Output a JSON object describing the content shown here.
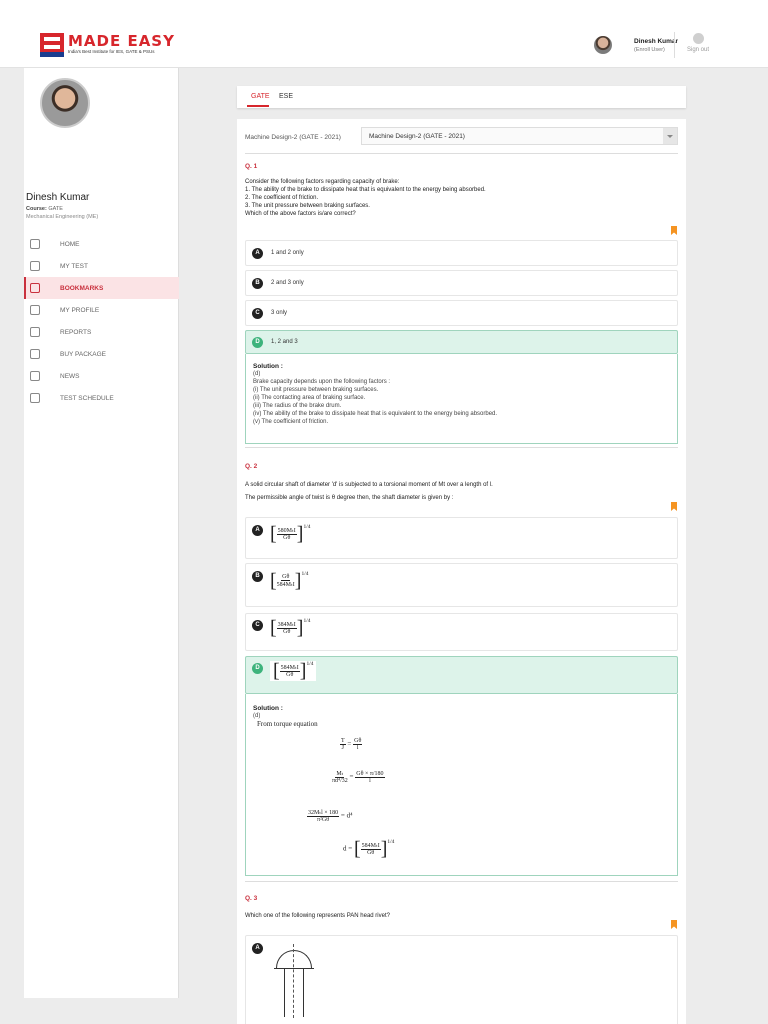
{
  "header": {
    "brand": "MADE EASY",
    "tagline": "India's Best Institute for IES, GATE & PSUs",
    "user_name": "Dinesh Kumar",
    "user_role": "(Enroll User)",
    "signout": "Sign out"
  },
  "sidebar": {
    "name": "Dinesh Kumar",
    "course_label": "Course:",
    "course": "GATE",
    "branch": "Mechanical Engineering (ME)",
    "items": [
      {
        "label": "HOME",
        "icon": "home-icon"
      },
      {
        "label": "MY TEST",
        "icon": "test-icon"
      },
      {
        "label": "BOOKMARKS",
        "icon": "bookmark-icon"
      },
      {
        "label": "MY PROFILE",
        "icon": "user-icon"
      },
      {
        "label": "REPORTS",
        "icon": "chart-icon"
      },
      {
        "label": "BUY PACKAGE",
        "icon": "cart-icon"
      },
      {
        "label": "NEWS",
        "icon": "news-icon"
      },
      {
        "label": "TEST SCHEDULE",
        "icon": "schedule-icon"
      }
    ]
  },
  "tabs": {
    "gate": "GATE",
    "ese": "ESE"
  },
  "filter": {
    "label": "Machine Design-2 (GATE - 2021)",
    "selected": "Machine Design-2 (GATE - 2021)"
  },
  "q1": {
    "num": "Q. 1",
    "lines": [
      "Consider the following factors regarding capacity of brake:",
      "1. The ability of the brake to dissipate heat that is equivalent to the energy being absorbed.",
      "2. The coefficient of friction.",
      "3. The unit pressure between braking surfaces.",
      "Which of the above factors is/are correct?"
    ],
    "options": [
      {
        "key": "A",
        "text": "1 and 2 only"
      },
      {
        "key": "B",
        "text": "2 and 3 only"
      },
      {
        "key": "C",
        "text": "3 only"
      },
      {
        "key": "D",
        "text": "1, 2 and 3"
      }
    ],
    "solution_title": "Solution :",
    "solution": [
      "(d)",
      "Brake capacity depends upon the following factors :",
      "(i) The unit pressure between braking surfaces.",
      "(ii) The contacting area of braking surface.",
      "(iii) The radius of the brake drum.",
      "(iv) The ability of the brake to dissipate heat that is equivalent to the energy being absorbed.",
      "(v) The coefficient of friction."
    ]
  },
  "q2": {
    "num": "Q. 2",
    "line1": "A solid circular shaft of diameter 'd' is subjected to a torsional moment of Mt over a length of l.",
    "line2": "The permissible angle of twist is θ degree then, the shaft diameter is given by :",
    "options": [
      {
        "key": "A",
        "num": "580MₜI",
        "den": "Gθ",
        "pow": "1/4"
      },
      {
        "key": "B",
        "num": "Gθ",
        "den": "584MₜI",
        "pow": "1/4"
      },
      {
        "key": "C",
        "num": "384MₜI",
        "den": "Gθ",
        "pow": "1/4"
      },
      {
        "key": "D",
        "num": "584MₜI",
        "den": "Gθ",
        "pow": "1/4"
      }
    ],
    "solution_title": "Solution :",
    "solution_answer": "(d)",
    "solution_intro": "From torque equation",
    "eq1": {
      "lnum": "T",
      "lden": "J",
      "rnum": "Gθ",
      "rden": "l"
    },
    "eq2": {
      "lnum": "Mₜ",
      "lden": "πd⁴/32",
      "rnum": "Gθ × π/180",
      "rden": "l"
    },
    "eq3": {
      "lnum": "32Mₜl × 180",
      "lden": "π²Gθ",
      "rhs": "= d⁴"
    },
    "eq4": {
      "lhs": "d =",
      "num": "584MₜI",
      "den": "Gθ",
      "pow": "1/4"
    }
  },
  "q3": {
    "num": "Q. 3",
    "text": "Which one of the following represents PAN head rivet?",
    "option_a": "A"
  },
  "colors": {
    "brand": "#d7262c",
    "correct": "#3db37c",
    "bookmark": "#f59422"
  }
}
